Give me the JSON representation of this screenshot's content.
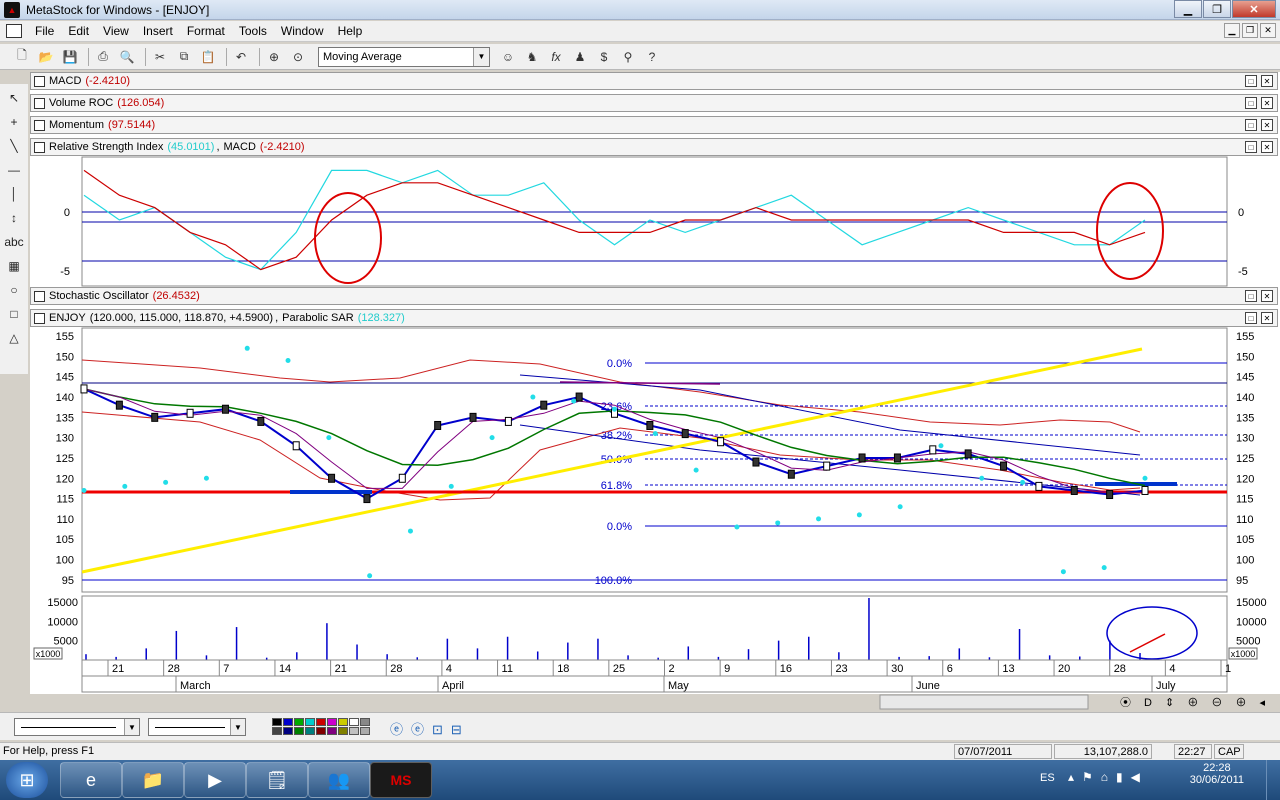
{
  "window": {
    "title": "MetaStock for Windows - [ENJOY]"
  },
  "menu": [
    "File",
    "Edit",
    "View",
    "Insert",
    "Format",
    "Tools",
    "Window",
    "Help"
  ],
  "toolbar": {
    "indicator_select": "Moving Average"
  },
  "panes": {
    "macd": {
      "label": "MACD",
      "value": "(-2.4210)"
    },
    "volroc": {
      "label": "Volume ROC",
      "value": "(126.054)"
    },
    "momentum": {
      "label": "Momentum",
      "value": "(97.5144)"
    },
    "rsi": {
      "label": "Relative Strength Index",
      "value": "(45.0101)",
      "label2": "MACD",
      "value2": "(-2.4210)"
    },
    "stoch": {
      "label": "Stochastic Oscillator",
      "value": "(26.4532)"
    },
    "price": {
      "label": "ENJOY",
      "value": "(120.000, 115.000, 118.870, +4.5900)",
      "label2": "Parabolic SAR",
      "value2": "(128.327)"
    }
  },
  "rsi_axis": [
    "0",
    "-5"
  ],
  "price_axis": [
    "155",
    "150",
    "145",
    "140",
    "135",
    "130",
    "125",
    "120",
    "115",
    "110",
    "105",
    "100",
    "95"
  ],
  "volume_axis": [
    "15000",
    "10000",
    "5000"
  ],
  "volume_unit": "x1000",
  "fib_labels": [
    "0.0%",
    "23.6%",
    "38.2%",
    "50.0%",
    "61.8%",
    "0.0%",
    "100.0%"
  ],
  "date_ticks": [
    "21",
    "28",
    "7",
    "14",
    "21",
    "28",
    "4",
    "11",
    "18",
    "25",
    "2",
    "9",
    "16",
    "23",
    "30",
    "6",
    "13",
    "20",
    "28",
    "4",
    "1"
  ],
  "months": [
    "March",
    "April",
    "May",
    "June",
    "July"
  ],
  "colors": {
    "rsi_line": "#22d8e0",
    "macd_line": "#cc0000",
    "sar": "#22dde8",
    "trend": "#ffee00",
    "support": "#ee0000",
    "ma_blue": "#0000cc",
    "ma_green": "#007700"
  },
  "status": {
    "help": "For Help, press F1",
    "date": "07/07/2011",
    "volume": "13,107,288.0",
    "time": "22:27",
    "caps": "CAP"
  },
  "tray": {
    "lang": "ES",
    "time": "22:28",
    "date": "30/06/2011"
  },
  "chart_data": [
    {
      "type": "line",
      "title": "Relative Strength Index / MACD",
      "ylim": [
        -6,
        4
      ],
      "series": [
        {
          "name": "Relative Strength Index",
          "values": [
            1,
            -1,
            0,
            -2,
            -4,
            -5,
            -2,
            3,
            3,
            2,
            3,
            1,
            1,
            2,
            -1,
            -3,
            -1,
            -2,
            -1,
            0,
            1,
            -1,
            -3,
            -2,
            -1,
            0,
            -1,
            -2,
            -3,
            -3,
            -1
          ]
        },
        {
          "name": "MACD",
          "values": [
            3,
            1,
            0,
            -2,
            -3,
            -5,
            -4,
            -1,
            1,
            2,
            2,
            1,
            0,
            -1,
            -2,
            -2,
            -2,
            -1,
            -1,
            0,
            -1,
            -1,
            -1,
            -1,
            -1,
            -1,
            -2,
            -2,
            -2,
            -3,
            -2
          ]
        }
      ]
    },
    {
      "type": "line",
      "title": "ENJOY",
      "ylim": [
        92,
        157
      ],
      "series": [
        {
          "name": "ENJOY",
          "values": [
            142,
            138,
            135,
            136,
            137,
            134,
            128,
            120,
            115,
            120,
            133,
            135,
            134,
            138,
            140,
            136,
            133,
            131,
            129,
            124,
            121,
            123,
            125,
            125,
            127,
            126,
            123,
            118,
            117,
            116,
            117
          ]
        },
        {
          "name": "Parabolic SAR",
          "values": [
            117,
            118,
            119,
            120,
            152,
            149,
            130,
            96,
            107,
            118,
            130,
            140,
            139,
            137,
            131,
            122,
            108,
            109,
            110,
            111,
            113,
            128,
            120,
            119,
            97,
            98,
            120
          ]
        }
      ]
    },
    {
      "type": "bar",
      "title": "Volume",
      "ylim": [
        0,
        16000
      ],
      "values": [
        1500,
        800,
        3000,
        7500,
        1200,
        8500,
        600,
        2000,
        9500,
        4000,
        1500,
        700,
        5500,
        3000,
        6000,
        2200,
        4500,
        5500,
        1200,
        600,
        3500,
        800,
        2800,
        5000,
        6000,
        2000,
        16000,
        800,
        1000,
        3000,
        700,
        8000,
        1200,
        900,
        5000,
        1800
      ]
    }
  ]
}
